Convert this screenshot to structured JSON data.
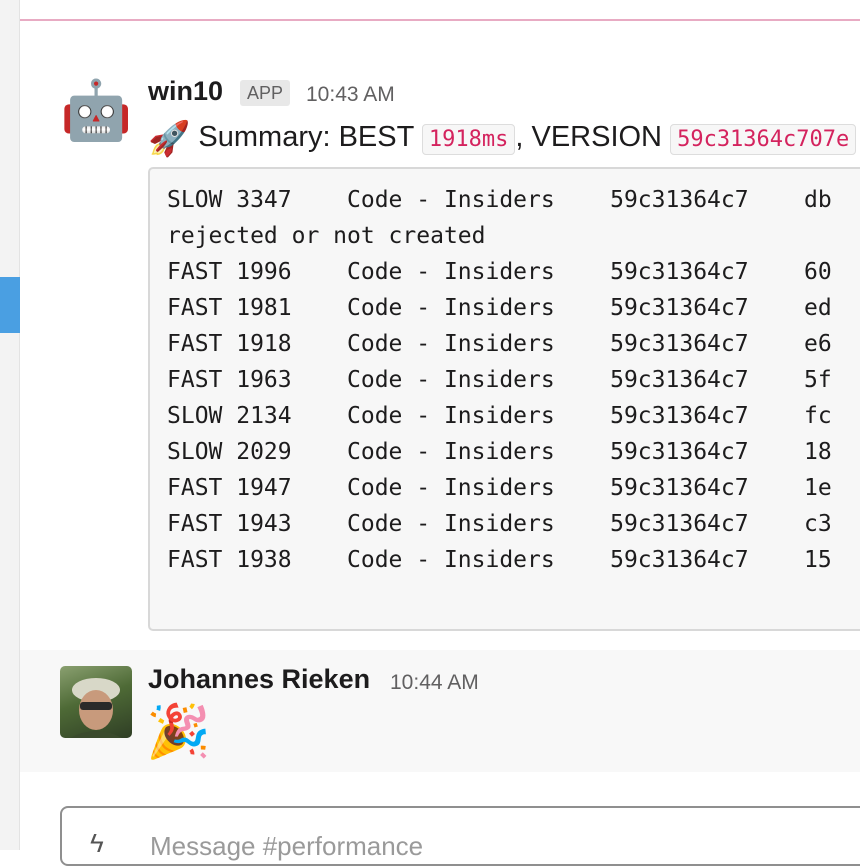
{
  "messages": [
    {
      "author": "win10",
      "badge": "APP",
      "time": "10:43 AM",
      "avatar_icon": "robot-face-icon",
      "summary": {
        "emoji": "🚀",
        "prefix": "Summary: BEST",
        "best_code": "1918ms",
        "mid": ", VERSION",
        "version_code": "59c31364c707e"
      },
      "code_lines": [
        "SLOW 3347    Code - Insiders    59c31364c7    db",
        "rejected or not created",
        "FAST 1996    Code - Insiders    59c31364c7    60",
        "FAST 1981    Code - Insiders    59c31364c7    ed",
        "FAST 1918    Code - Insiders    59c31364c7    e6",
        "FAST 1963    Code - Insiders    59c31364c7    5f",
        "SLOW 2134    Code - Insiders    59c31364c7    fc",
        "SLOW 2029    Code - Insiders    59c31364c7    18",
        "FAST 1947    Code - Insiders    59c31364c7    1e",
        "FAST 1943    Code - Insiders    59c31364c7    c3",
        "FAST 1938    Code - Insiders    59c31364c7    15"
      ]
    },
    {
      "author": "Johannes Rieken",
      "time": "10:44 AM",
      "emoji": "🎉"
    }
  ],
  "composer": {
    "placeholder": "Message #performance",
    "icon": "lightning-shortcut-icon"
  },
  "colors": {
    "new_divider": "#e8abc3",
    "inline_code": "#d4235e",
    "rail_marker": "#4a9fe2"
  }
}
